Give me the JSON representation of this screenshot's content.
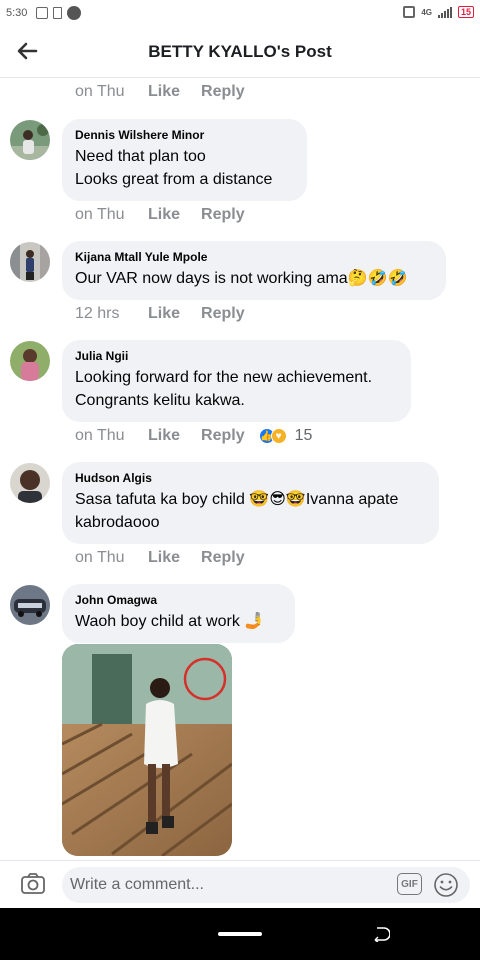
{
  "status_bar": {
    "time": "5:30",
    "network": "4G",
    "battery": "15"
  },
  "header": {
    "title": "BETTY KYALLO's Post"
  },
  "comments": [
    {
      "author": "",
      "text": "",
      "time": "on Thu",
      "like_label": "Like",
      "reply_label": "Reply"
    },
    {
      "author": "Dennis Wilshere Minor",
      "text": "Need that plan too\nLooks great from a distance",
      "time": "on Thu",
      "like_label": "Like",
      "reply_label": "Reply"
    },
    {
      "author": "Kijana Mtall Yule Mpole",
      "text": "Our VAR now days is not working ama🤔🤣🤣",
      "time": "12 hrs",
      "like_label": "Like",
      "reply_label": "Reply"
    },
    {
      "author": "Julia Ngii",
      "text": "Looking forward for the new achievement.\nCongrants kelitu kakwa.",
      "time": "on Thu",
      "like_label": "Like",
      "reply_label": "Reply",
      "reaction_count": "15"
    },
    {
      "author": "Hudson Algis",
      "text": "Sasa tafuta ka boy child 🤓😎🤓Ivanna apate\nkabrodaooo",
      "time": "on Thu",
      "like_label": "Like",
      "reply_label": "Reply"
    },
    {
      "author": "John Omagwa",
      "text": "Waoh boy child at work 🤳"
    }
  ],
  "composer": {
    "placeholder": "Write a comment...",
    "gif_label": "GIF"
  },
  "colors": {
    "bubble": "#f0f2f5",
    "meta_text": "#8a8d91",
    "like_reaction": "#1877f2",
    "battery_alert": "#e41e3f"
  }
}
